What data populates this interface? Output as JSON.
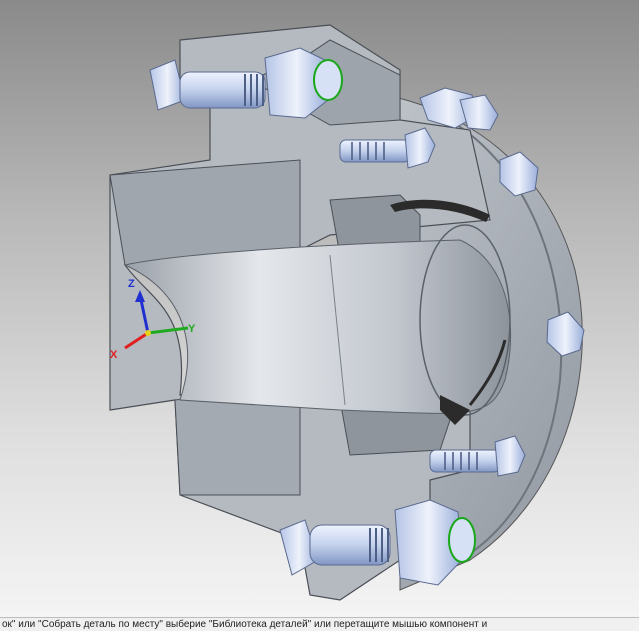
{
  "viewport": {
    "colors": {
      "metal_light": "#e2e5ea",
      "metal_mid": "#b9bec6",
      "metal_dark": "#7f858e",
      "bolt": "#c9d6ee",
      "bolt_shade": "#8ea4cf",
      "seal": "#2b2b2b",
      "edge_green": "#19a819"
    }
  },
  "triad": {
    "x_label": "X",
    "y_label": "Y",
    "z_label": "Z",
    "x_color": "#e02020",
    "y_color": "#1faa1f",
    "z_color": "#2030d0"
  },
  "status": {
    "text": "ок\" или \"Собрать деталь по месту\" выберие \"Библиотека деталей\" или перетащите мышью компонент и"
  }
}
